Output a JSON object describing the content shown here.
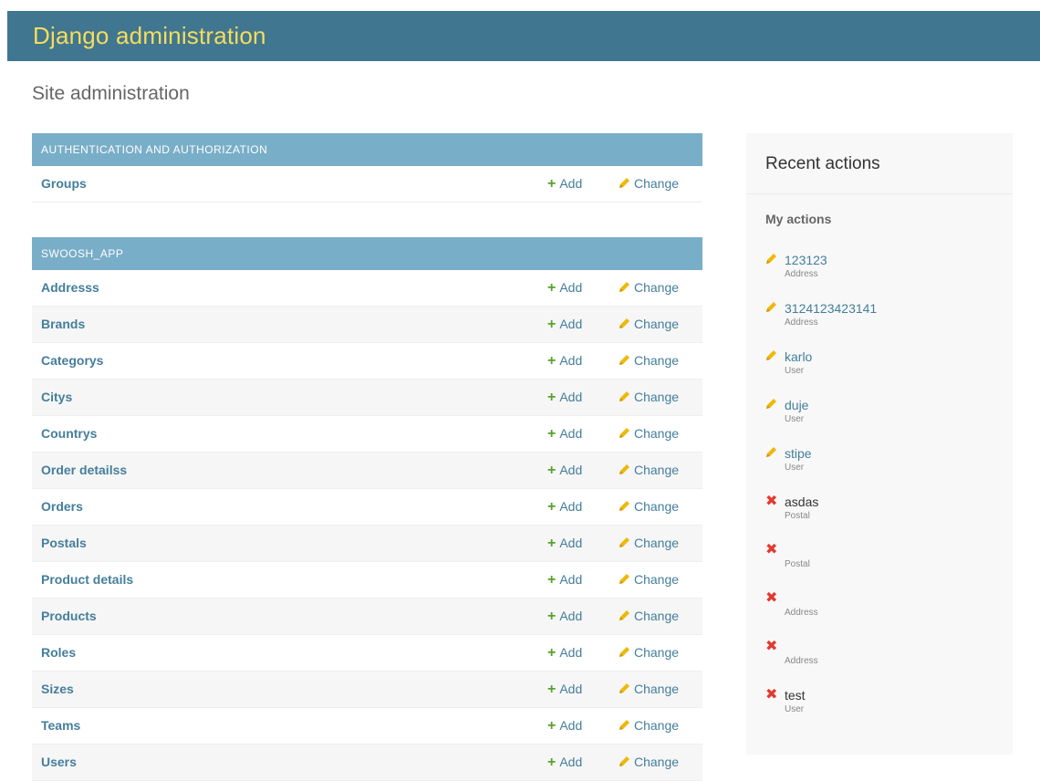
{
  "header": {
    "branding": "Django administration"
  },
  "page": {
    "title": "Site administration"
  },
  "modules": [
    {
      "caption": "Authentication and Authorization",
      "models": [
        {
          "name": "Groups"
        }
      ]
    },
    {
      "caption": "Swoosh_app",
      "models": [
        {
          "name": "Addresss"
        },
        {
          "name": "Brands"
        },
        {
          "name": "Categorys"
        },
        {
          "name": "Citys"
        },
        {
          "name": "Countrys"
        },
        {
          "name": "Order detailss"
        },
        {
          "name": "Orders"
        },
        {
          "name": "Postals"
        },
        {
          "name": "Product details"
        },
        {
          "name": "Products"
        },
        {
          "name": "Roles"
        },
        {
          "name": "Sizes"
        },
        {
          "name": "Teams"
        },
        {
          "name": "Users"
        }
      ]
    }
  ],
  "actions_labels": {
    "add": "Add",
    "change": "Change"
  },
  "recent_actions": {
    "title": "Recent actions",
    "subtitle": "My actions",
    "items": [
      {
        "kind": "change",
        "text": "123123",
        "type": "Address"
      },
      {
        "kind": "change",
        "text": "3124123423141",
        "type": "Address"
      },
      {
        "kind": "change",
        "text": "karlo",
        "type": "User"
      },
      {
        "kind": "change",
        "text": "duje",
        "type": "User"
      },
      {
        "kind": "change",
        "text": "stipe",
        "type": "User"
      },
      {
        "kind": "delete",
        "text": "asdas",
        "type": "Postal"
      },
      {
        "kind": "delete",
        "text": "",
        "type": "Postal"
      },
      {
        "kind": "delete",
        "text": "",
        "type": "Address"
      },
      {
        "kind": "delete",
        "text": "",
        "type": "Address"
      },
      {
        "kind": "delete",
        "text": "test",
        "type": "User"
      }
    ]
  },
  "colors": {
    "header_bg": "#417690",
    "branding": "#f5dd5d",
    "caption_bg": "#79aec8",
    "link": "#447e9b",
    "add_icon": "#5aa02c",
    "change_icon": "#efb80b",
    "delete_icon": "#e23a31"
  },
  "icons": {
    "add": "plus-icon",
    "change": "pencil-icon",
    "delete": "x-icon"
  }
}
